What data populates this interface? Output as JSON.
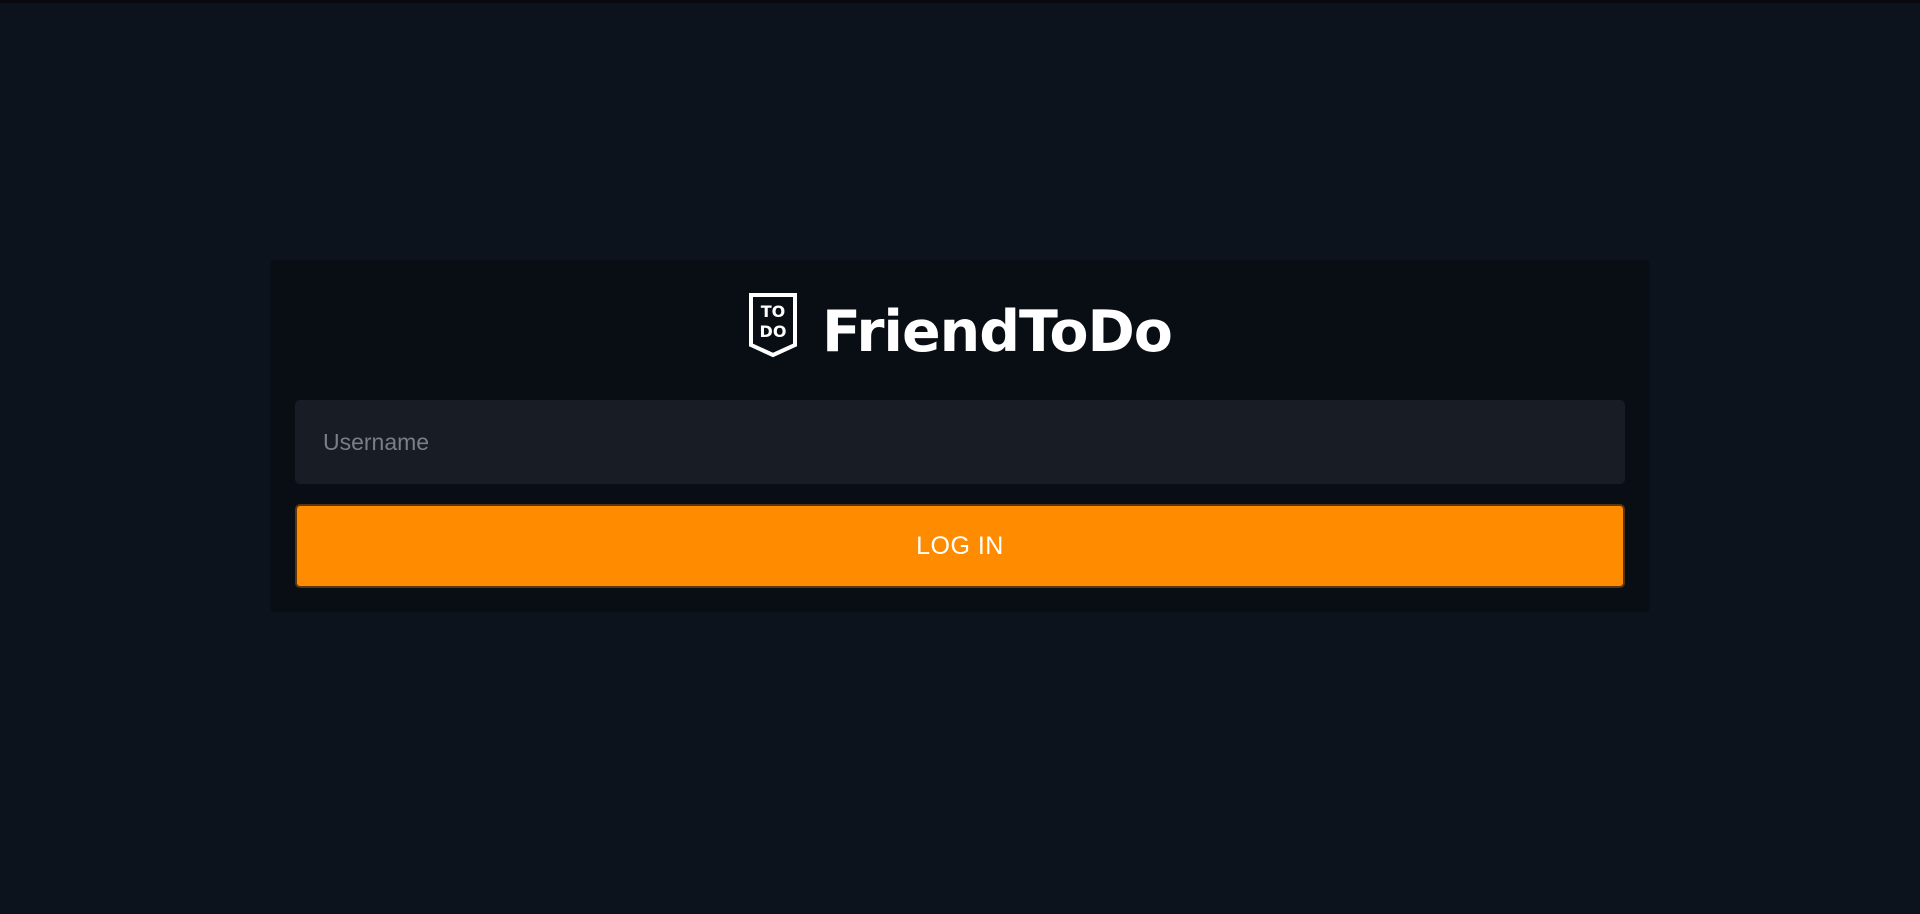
{
  "app": {
    "name": "FriendToDo",
    "logo_icon": "todo-shield-logo",
    "logo_text_top": "TO",
    "logo_text_bottom": "DO"
  },
  "login_form": {
    "username_placeholder": "Username",
    "username_value": "",
    "submit_label": "LOG IN"
  },
  "colors": {
    "background": "#0d131d",
    "card": "#090d14",
    "input": "#181c25",
    "accent": "#ff8c00",
    "text": "#ffffff"
  }
}
